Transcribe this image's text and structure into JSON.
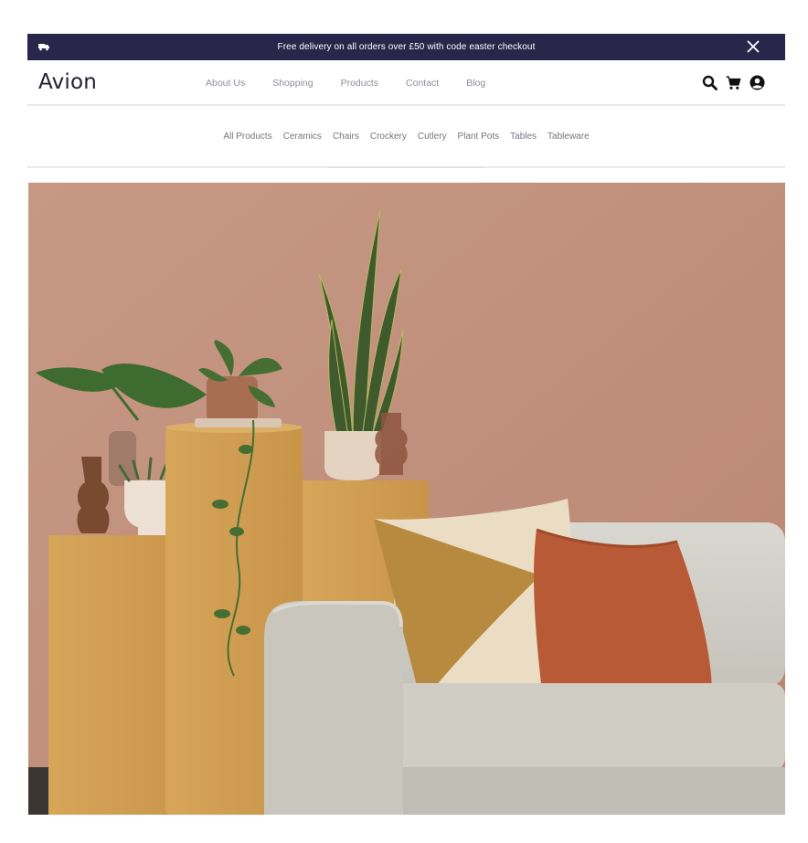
{
  "announcement": {
    "text": "Free delivery on all orders over £50 with code easter checkout",
    "icon": "truck-icon",
    "close_icon": "close-icon"
  },
  "header": {
    "logo": "Avion",
    "nav": [
      "About Us",
      "Shopping",
      "Products",
      "Contact",
      "Blog"
    ],
    "icons": [
      "search-icon",
      "cart-icon",
      "user-icon"
    ]
  },
  "categories": [
    "All Products",
    "Ceramics",
    "Chairs",
    "Crockery",
    "Cutlery",
    "Plant Pots",
    "Tables",
    "Tableware"
  ],
  "colors": {
    "announcement_bg": "#2a254b",
    "text_primary": "#22202e",
    "nav_text": "#8f8e99",
    "wall": "#c1917c"
  }
}
